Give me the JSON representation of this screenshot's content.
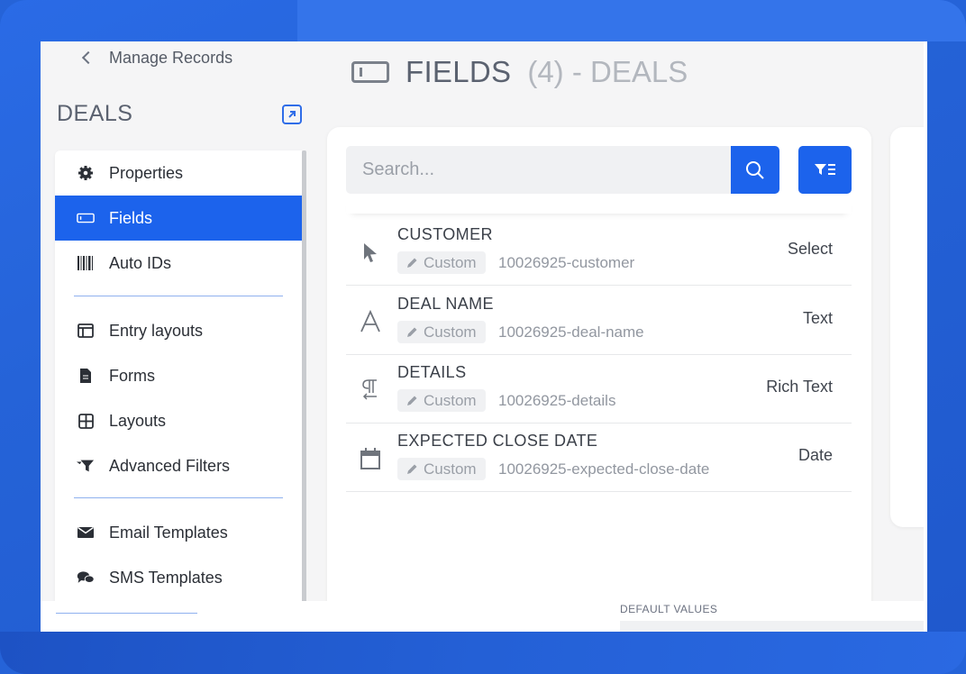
{
  "back_link": {
    "label": "Manage Records"
  },
  "record": {
    "name": "DEALS"
  },
  "sidebar": {
    "items": [
      {
        "label": "Properties",
        "icon": "gear-icon",
        "active": false
      },
      {
        "label": "Fields",
        "icon": "field-icon",
        "active": true
      },
      {
        "label": "Auto IDs",
        "icon": "barcode-icon",
        "active": false
      },
      {
        "label": "Entry layouts",
        "icon": "entry-layout-icon",
        "active": false
      },
      {
        "label": "Forms",
        "icon": "document-icon",
        "active": false
      },
      {
        "label": "Layouts",
        "icon": "grid-icon",
        "active": false
      },
      {
        "label": "Advanced Filters",
        "icon": "filter-icon",
        "active": false
      },
      {
        "label": "Email Templates",
        "icon": "envelope-icon",
        "active": false
      },
      {
        "label": "SMS Templates",
        "icon": "chat-icon",
        "active": false
      }
    ]
  },
  "header": {
    "title": "FIELDS",
    "count": "(4)",
    "suffix": "- DEALS"
  },
  "search": {
    "placeholder": "Search...",
    "value": ""
  },
  "fields": [
    {
      "name": "CUSTOMER",
      "badge": "Custom",
      "key": "10026925-customer",
      "type": "Select",
      "icon": "cursor-icon"
    },
    {
      "name": "DEAL NAME",
      "badge": "Custom",
      "key": "10026925-deal-name",
      "type": "Text",
      "icon": "text-icon"
    },
    {
      "name": "DETAILS",
      "badge": "Custom",
      "key": "10026925-details",
      "type": "Rich Text",
      "icon": "paragraph-icon"
    },
    {
      "name": "EXPECTED CLOSE DATE",
      "badge": "Custom",
      "key": "10026925-expected-close-date",
      "type": "Date",
      "icon": "calendar-icon"
    }
  ],
  "bottom": {
    "default_values_label": "DEFAULT VALUES"
  },
  "colors": {
    "accent": "#1c63ec",
    "background": "#2563d8",
    "panel": "#ffffff",
    "page": "#f5f5f6"
  }
}
